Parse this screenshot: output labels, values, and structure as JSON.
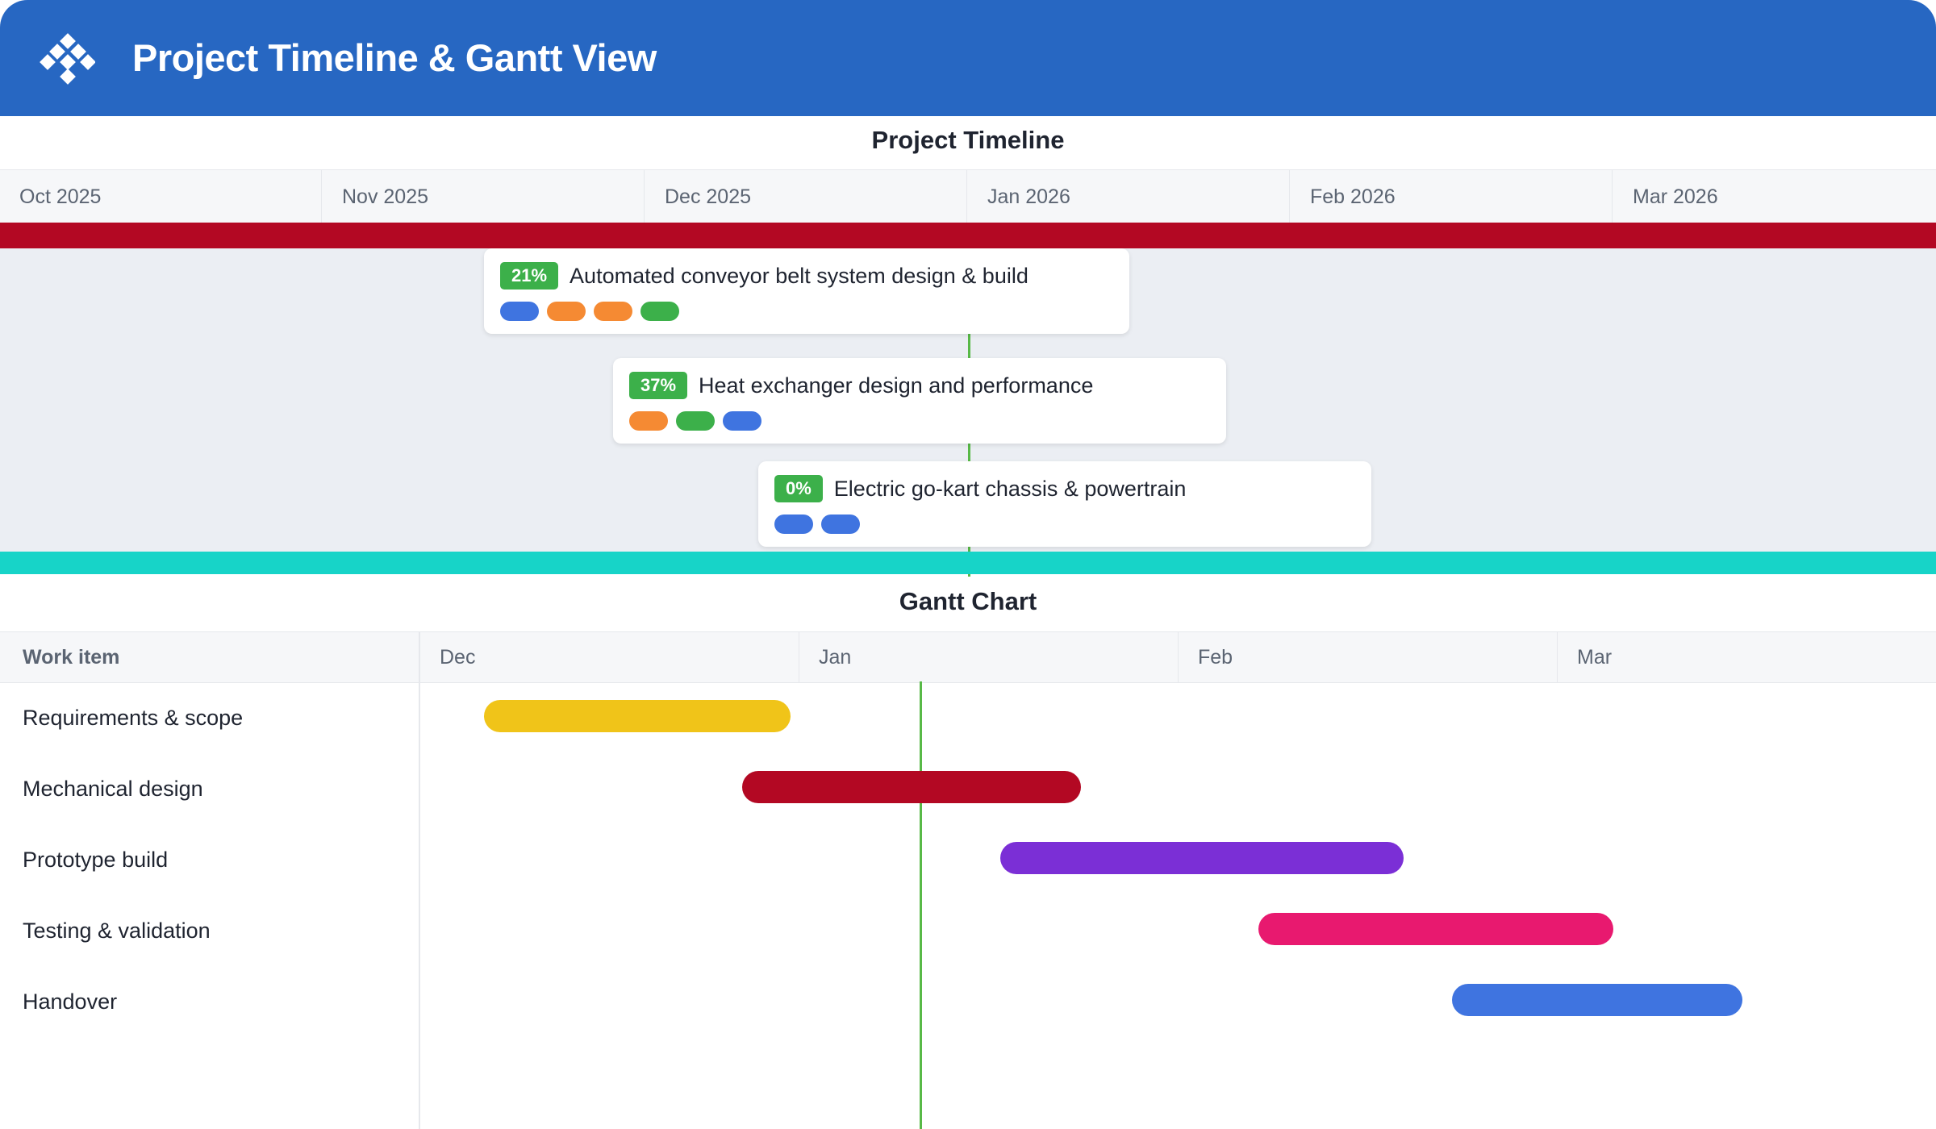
{
  "app": {
    "title": "Project Timeline & Gantt View",
    "logo_icon": "diamond-grid-logo-icon"
  },
  "timeline": {
    "title": "Project Timeline",
    "months": [
      "Oct 2025",
      "Nov 2025",
      "Dec 2025",
      "Jan 2026",
      "Feb 2026",
      "Mar 2026"
    ],
    "band_colors": {
      "top": "#b30823",
      "bottom": "#17d4c8"
    },
    "today_line_color": "#58b947",
    "projects": [
      {
        "percent": "21%",
        "progress": 0.21,
        "title": "Automated conveyor belt system design & build",
        "tags": [
          "#3f74e0",
          "#f58a33",
          "#f58a33",
          "#3cb04a"
        ]
      },
      {
        "percent": "37%",
        "progress": 0.37,
        "title": "Heat exchanger design and performance",
        "tags": [
          "#f58a33",
          "#3cb04a",
          "#3f74e0"
        ]
      },
      {
        "percent": "0%",
        "progress": 0.0,
        "title": "Electric go-kart chassis & powertrain",
        "tags": [
          "#3f74e0",
          "#3f74e0"
        ]
      }
    ]
  },
  "gantt": {
    "title": "Gantt Chart",
    "column_label": "Work item",
    "months": [
      "Dec",
      "Jan",
      "Feb",
      "Mar"
    ],
    "rows": [
      {
        "label": "Requirements & scope",
        "color": "#f0c419"
      },
      {
        "label": "Mechanical design",
        "color": "#b30823"
      },
      {
        "label": "Prototype build",
        "color": "#7b2fd6"
      },
      {
        "label": "Testing & validation",
        "color": "#e8196f"
      },
      {
        "label": "Handover",
        "color": "#3f74e0"
      }
    ]
  }
}
